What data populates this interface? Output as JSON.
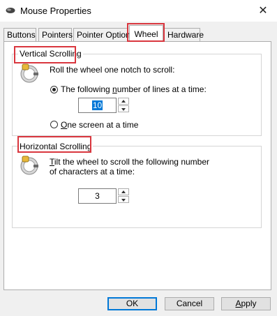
{
  "window": {
    "title": "Mouse Properties",
    "close_glyph": "✕",
    "icon": "mouse-icon"
  },
  "tabs": [
    {
      "label": "Buttons",
      "active": false
    },
    {
      "label": "Pointers",
      "active": false
    },
    {
      "label": "Pointer Options",
      "active": false
    },
    {
      "label": "Wheel",
      "active": true
    },
    {
      "label": "Hardware",
      "active": false
    }
  ],
  "vertical": {
    "title": "Vertical Scrolling",
    "description": "Roll the wheel one notch to scroll:",
    "option_lines_pre": "The following ",
    "option_lines_ul": "n",
    "option_lines_post": "umber of lines at a time:",
    "lines_value": "10",
    "option_screen_ul": "O",
    "option_screen_post": "ne screen at a time",
    "selected_option": "lines"
  },
  "horizontal": {
    "title": "Horizontal Scrolling",
    "line1_ul": "T",
    "line1_post": "ilt the wheel to scroll the following number",
    "line2": "of characters at a time:",
    "chars_value": "3"
  },
  "buttons": {
    "ok": "OK",
    "cancel": "Cancel",
    "apply_ul": "A",
    "apply_post": "pply"
  },
  "colors": {
    "highlight": "#d9363e",
    "default_button_border": "#0078d7",
    "selection": "#0078d7"
  }
}
